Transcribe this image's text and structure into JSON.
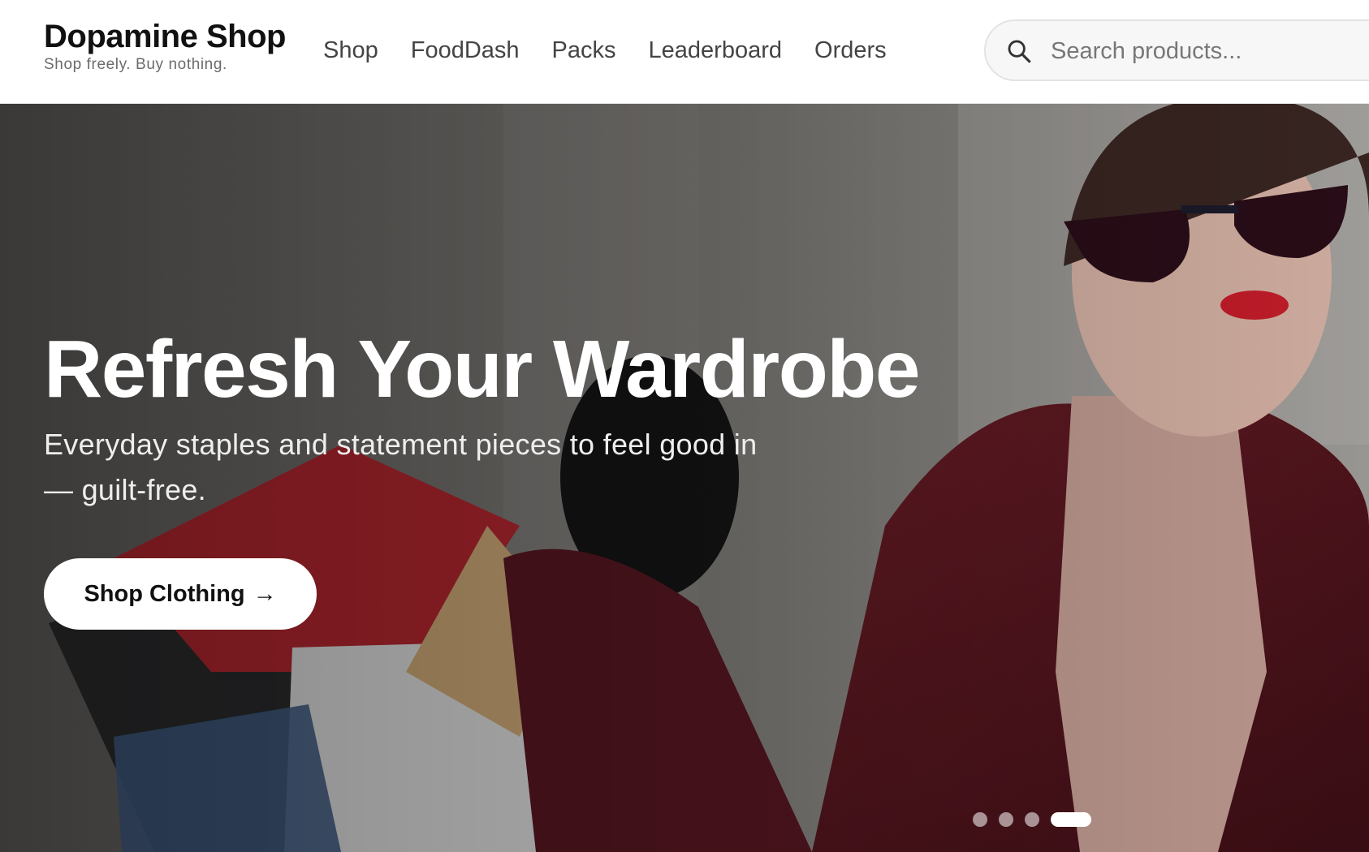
{
  "brand": {
    "name": "Dopamine Shop",
    "tagline": "Shop freely. Buy nothing."
  },
  "nav": {
    "items": [
      {
        "label": "Shop"
      },
      {
        "label": "FoodDash"
      },
      {
        "label": "Packs"
      },
      {
        "label": "Leaderboard"
      },
      {
        "label": "Orders"
      }
    ]
  },
  "search": {
    "placeholder": "Search products...",
    "value": "",
    "icon": "search-icon"
  },
  "hero": {
    "title": "Refresh Your Wardrobe",
    "subtitle": "Everyday staples and statement pieces to feel good in — guilt-free.",
    "cta_label": "Shop Clothing",
    "cta_icon": "arrow-right-icon",
    "slide_count": 4,
    "active_slide": 4
  },
  "colors": {
    "accent": "#ffffff",
    "text": "#111111",
    "coat": "#5a1a22",
    "shopping_bag_red": "#c8202a"
  }
}
